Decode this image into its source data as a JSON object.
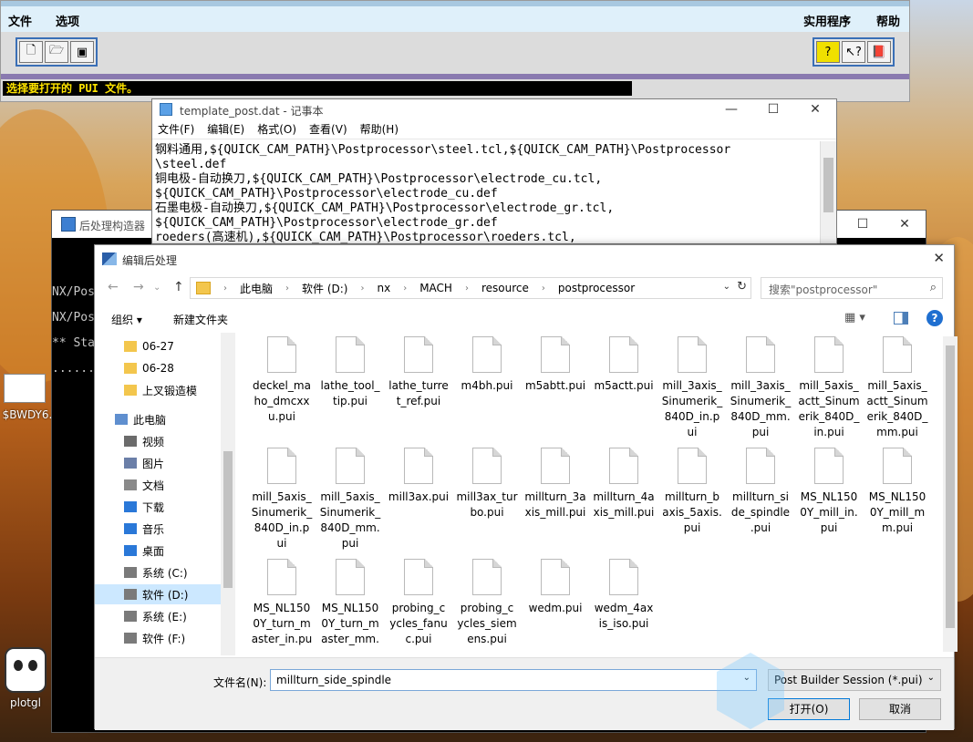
{
  "postbuilder": {
    "menu_file": "文件",
    "menu_options": "选项",
    "menu_utilities": "实用程序",
    "menu_help": "帮助",
    "status": "选择要打开的 PUI 文件。"
  },
  "notepad": {
    "title": "template_post.dat - 记事本",
    "menu": [
      "文件(F)",
      "编辑(E)",
      "格式(O)",
      "查看(V)",
      "帮助(H)"
    ],
    "lines": [
      "钢料通用,${QUICK_CAM_PATH}\\Postprocessor\\steel.tcl,${QUICK_CAM_PATH}\\Postprocessor",
      "\\steel.def",
      "铜电极-自动换刀,${QUICK_CAM_PATH}\\Postprocessor\\electrode_cu.tcl,",
      "${QUICK_CAM_PATH}\\Postprocessor\\electrode_cu.def",
      "石墨电极-自动换刀,${QUICK_CAM_PATH}\\Postprocessor\\electrode_gr.tcl,",
      "${QUICK_CAM_PATH}\\Postprocessor\\electrode_gr.def",
      "roeders(高速机),${QUICK_CAM_PATH}\\Postprocessor\\roeders.tcl,"
    ]
  },
  "backwindow": {
    "title": "后处理构造器",
    "console": [
      "NX/Pos",
      "NX/Pos",
      "** Sta",
      "......"
    ]
  },
  "dialog": {
    "title": "编辑后处理",
    "breadcrumb": [
      "此电脑",
      "软件 (D:)",
      "nx",
      "MACH",
      "resource",
      "postprocessor"
    ],
    "search_placeholder": "搜索\"postprocessor\"",
    "organize": "组织 ▾",
    "new_folder": "新建文件夹",
    "nav": [
      {
        "label": "06-27",
        "icon": "folder"
      },
      {
        "label": "06-28",
        "icon": "folder"
      },
      {
        "label": "上叉锻造模",
        "icon": "folder"
      },
      {
        "label": "此电脑",
        "icon": "pc"
      },
      {
        "label": "视频",
        "icon": "video"
      },
      {
        "label": "图片",
        "icon": "picture"
      },
      {
        "label": "文档",
        "icon": "document"
      },
      {
        "label": "下载",
        "icon": "download"
      },
      {
        "label": "音乐",
        "icon": "music"
      },
      {
        "label": "桌面",
        "icon": "desktop"
      },
      {
        "label": "系统 (C:)",
        "icon": "drive"
      },
      {
        "label": "软件 (D:)",
        "icon": "drive"
      },
      {
        "label": "系统 (E:)",
        "icon": "drive"
      },
      {
        "label": "软件 (F:)",
        "icon": "drive"
      }
    ],
    "files": [
      [
        "deckel_ma",
        "ho_dmcxx",
        "u.pui"
      ],
      [
        "lathe_tool_",
        "tip.pui"
      ],
      [
        "lathe_turre",
        "t_ref.pui"
      ],
      [
        "m4bh.pui"
      ],
      [
        "m5abtt.pui"
      ],
      [
        "m5actt.pui"
      ],
      [
        "mill_3axis_",
        "Sinumerik_",
        "840D_in.p",
        "ui"
      ],
      [
        "mill_3axis_",
        "Sinumerik_",
        "840D_mm.",
        "pui"
      ],
      [
        "mill_5axis_",
        "actt_Sinum",
        "erik_840D_",
        "in.pui"
      ],
      [
        "mill_5axis_",
        "actt_Sinum",
        "erik_840D_",
        "mm.pui"
      ],
      [
        "mill_5axis_",
        "Sinumerik_",
        "840D_in.p",
        "ui"
      ],
      [
        "mill_5axis_",
        "Sinumerik_",
        "840D_mm.",
        "pui"
      ],
      [
        "mill3ax.pui"
      ],
      [
        "mill3ax_tur",
        "bo.pui"
      ],
      [
        "millturn_3a",
        "xis_mill.pui"
      ],
      [
        "millturn_4a",
        "xis_mill.pui"
      ],
      [
        "millturn_b",
        "axis_5axis.",
        "pui"
      ],
      [
        "millturn_si",
        "de_spindle",
        ".pui"
      ],
      [
        "MS_NL150",
        "0Y_mill_in.",
        "pui"
      ],
      [
        "MS_NL150",
        "0Y_mill_m",
        "m.pui"
      ],
      [
        "MS_NL150",
        "0Y_turn_m",
        "aster_in.pu"
      ],
      [
        "MS_NL150",
        "0Y_turn_m",
        "aster_mm."
      ],
      [
        "probing_c",
        "ycles_fanu",
        "c.pui"
      ],
      [
        "probing_c",
        "ycles_siem",
        "ens.pui"
      ],
      [
        "wedm.pui"
      ],
      [
        "wedm_4ax",
        "is_iso.pui"
      ]
    ],
    "filename_label": "文件名(N):",
    "filename_value": "millturn_side_spindle",
    "filetype": "Post Builder Session (*.pui)",
    "open_label": "打开(O)",
    "cancel_label": "取消"
  },
  "desktop": {
    "thumb_label": "$BWDY6.",
    "plotgl_label": "plotgl"
  }
}
